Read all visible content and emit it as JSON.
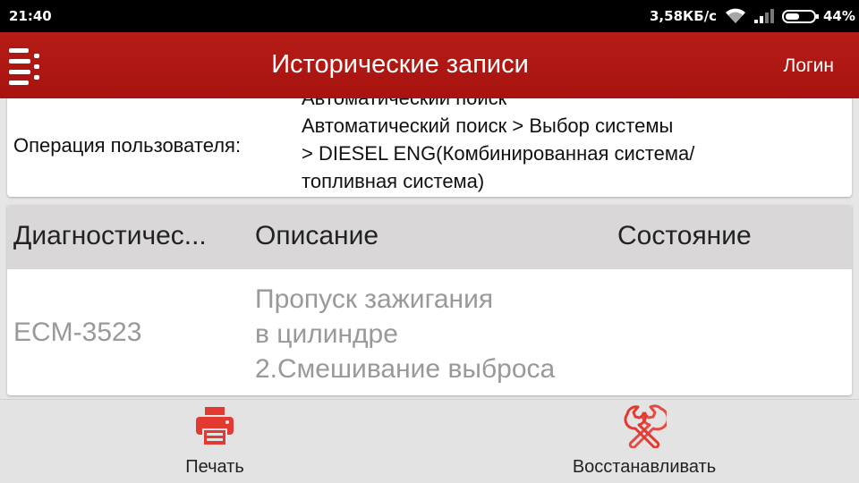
{
  "status_bar": {
    "time": "21:40",
    "net_speed": "3,58КБ/с",
    "battery": "44%",
    "icons": [
      "wifi-icon",
      "signal-icon",
      "battery-icon"
    ]
  },
  "app_bar": {
    "title": "Исторические записи",
    "login": "Логин",
    "menu_icon": "menu-icon",
    "color": "#ac1611"
  },
  "operation": {
    "label": "Операция пользователя:",
    "lines": [
      "Автоматический поиск",
      "Автоматический поиск > Выбор системы",
      "> DIESEL ENG(Комбинированная система/",
      "топливная система)"
    ]
  },
  "table": {
    "headers": [
      "Диагностичес...",
      "Описание",
      "Состояние"
    ],
    "rows": [
      {
        "code": "ECM-3523",
        "description": [
          "Пропуск зажигания",
          "в цилиндре",
          "2.Смешивание выброса"
        ],
        "status": ""
      }
    ]
  },
  "bottom_bar": {
    "print": {
      "label": "Печать",
      "icon": "printer-icon"
    },
    "restore": {
      "label": "Восстанавливать",
      "icon": "wrench-icon"
    },
    "icon_color": "#e23a31"
  }
}
